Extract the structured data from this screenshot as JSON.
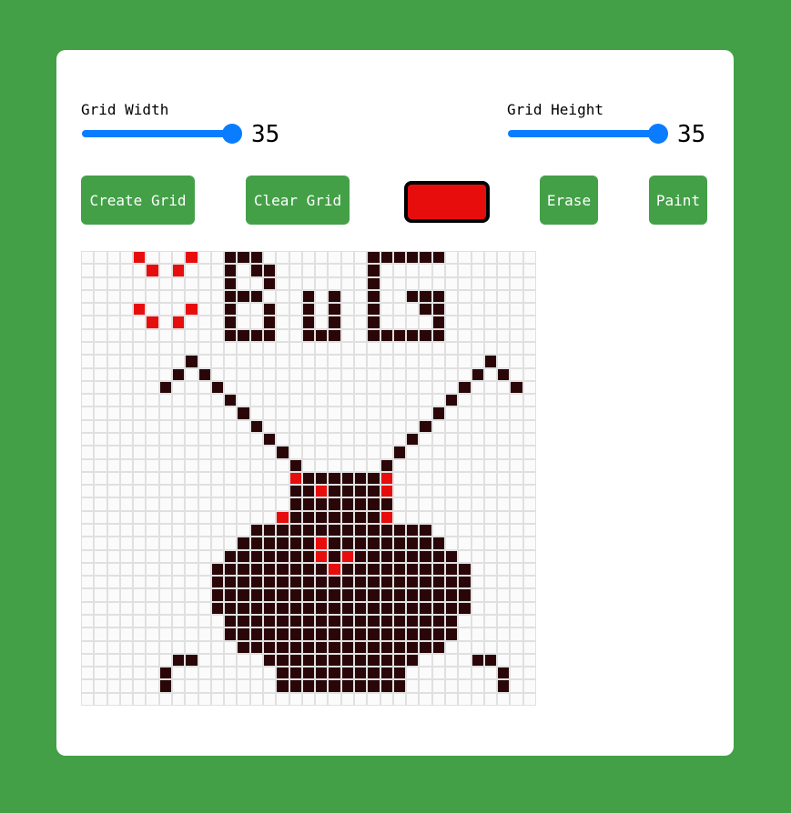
{
  "controls": {
    "width_label": "Grid Width",
    "width_value": "35",
    "width_slider_level": 1.0,
    "height_label": "Grid Height",
    "height_value": "35",
    "height_slider_level": 1.0
  },
  "buttons": {
    "create": "Create Grid",
    "clear": "Clear Grid",
    "erase": "Erase",
    "paint": "Paint"
  },
  "colors": {
    "background": "#43a047",
    "accent": "#0a7cff",
    "selected_paint": "#e80d0d",
    "dark_paint": "#2a0608",
    "empty_cell": "#fbfbfb"
  },
  "grid": {
    "rows": 35,
    "cols": 35,
    "pixels": [
      "....R...R..DDD........DDDDDD.......",
      ".....R.R...D.DD.......D............",
      "...........D..D.......D............",
      "...........DDD...D.D..D..DDD.......",
      "....R...R..D..D..D.D..D...DD.......",
      ".....R.R...D..D..D.D..D....D.......",
      "...........DDDD..DDD..DDDDDD.......",
      "...................................",
      "........D......................D...",
      ".......D.D....................D.D..",
      "......D...D..................D...D.",
      "...........D................D......",
      "............D..............D.......",
      ".............D............D........",
      "..............D..........D.........",
      "...............D........D..........",
      "................D......D...........",
      "................RDDDDDDR...........",
      "................DDRDDDDR...........",
      "................DDDDDDDD...........",
      "...............RDDDDDDDR...........",
      ".............DDDDDDDDDDDDDD........",
      "............DDDDDDRDDDDDDDDD.......",
      "...........DDDDDDDRDRDDDDDDDD......",
      "..........DDDDDDDDDRDDDDDDDDDD.....",
      "..........DDDDDDDDDDDDDDDDDDDD.....",
      "..........DDDDDDDDDDDDDDDDDDDD.....",
      "..........DDDDDDDDDDDDDDDDDDDD.....",
      "...........DDDDDDDDDDDDDDDDDD......",
      "...........DDDDDDDDDDDDDDDDDD......",
      "............DDDDDDDDDDDDDDDD.......",
      ".......DD.....DDDDDDDDDDDD....DD...",
      "......D........DDDDDDDDDD.......D..",
      "......D........DDDDDDDDDD.......D..",
      "..................................."
    ]
  }
}
